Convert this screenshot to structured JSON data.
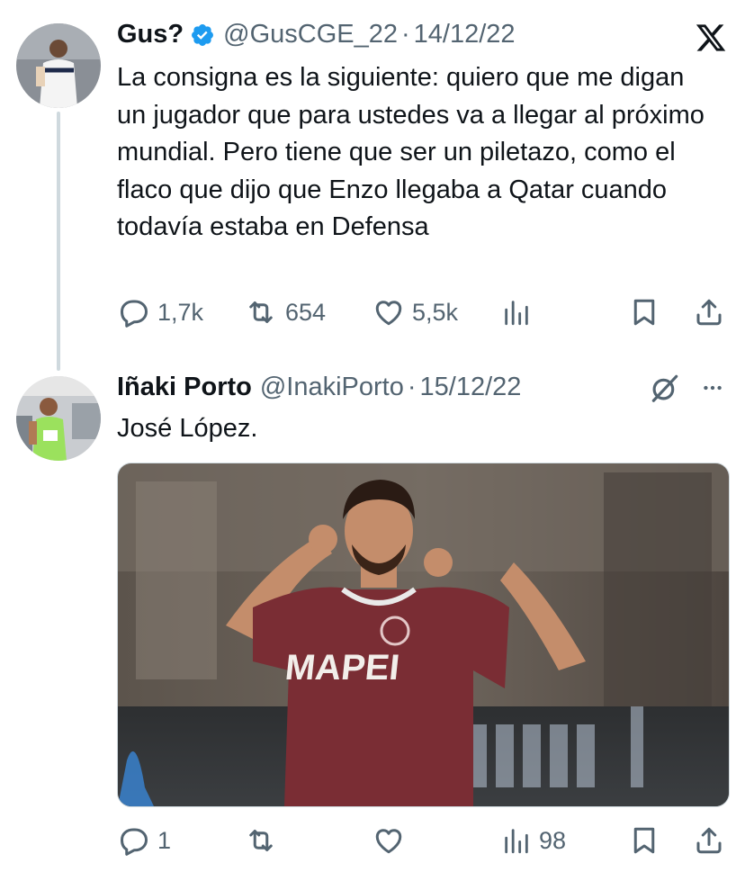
{
  "tweet1": {
    "name": "Gus?",
    "handle": "@GusCGE_22",
    "separator": "·",
    "date": "14/12/22",
    "text": "La consigna es la siguiente: quiero que me digan un jugador que para ustedes va a llegar al próximo mundial. Pero tiene que ser un piletazo, como el flaco que dijo que Enzo llegaba a Qatar cuando todavía estaba en Defensa",
    "replies": "1,7k",
    "retweets": "654",
    "likes": "5,5k",
    "icons": [
      "verified-badge-icon",
      "x-logo-icon",
      "reply-icon",
      "retweet-icon",
      "like-icon",
      "views-icon",
      "bookmark-icon",
      "share-icon"
    ]
  },
  "tweet2": {
    "name": "Iñaki Porto",
    "handle": "@InakiPorto",
    "separator": "·",
    "date": "15/12/22",
    "text": "José López.",
    "replies": "1",
    "views": "98",
    "image_caption": "MAPEI",
    "icons": [
      "grok-icon",
      "more-icon",
      "reply-icon",
      "retweet-icon",
      "like-icon",
      "views-icon",
      "bookmark-icon",
      "share-icon"
    ]
  },
  "colors": {
    "text": "#0f1419",
    "secondary": "#536471",
    "verified": "#1d9bf0",
    "thread_line": "#cfd9de",
    "jersey": "#7a2d34"
  }
}
